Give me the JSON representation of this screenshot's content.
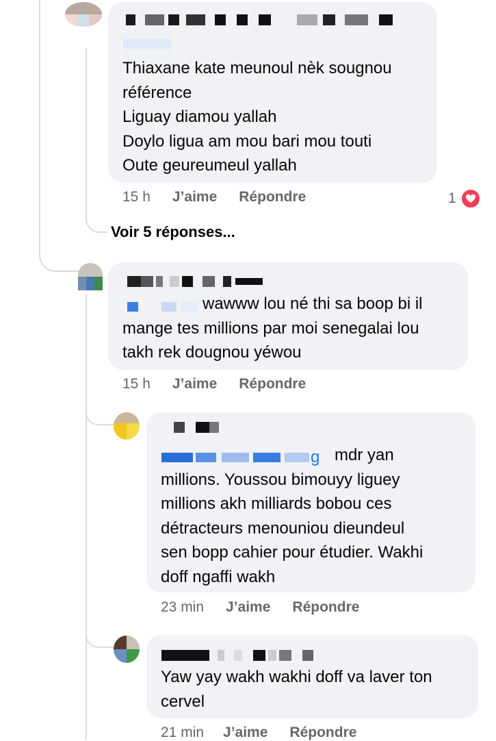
{
  "comments": [
    {
      "text": "Thiaxane kate meunoul nèk sougnou\nréférence\nLiguay diamou yallah\nDoylo ligua am mou bari mou touti\nOute geureumeul yallah",
      "time": "15 h",
      "like_label": "J’aime",
      "reply_label": "Répondre",
      "reaction_count": "1",
      "reaction_icon": "heart-icon"
    },
    {
      "text": "wawww lou né thi sa boop bi il\nmange tes millions par moi senegalai lou\ntakh rek dougnou yéwou",
      "time": "15 h",
      "like_label": "J’aime",
      "reply_label": "Répondre"
    },
    {
      "mention_tail": "g",
      "text": "mdr yan\nmillions.  Youssou bimouyy liguey\nmillions akh milliards bobou ces\ndétracteurs menouniou dieundeul\nsen bopp cahier pour étudier.  Wakhi\ndoff ngaffi wakh",
      "time": "23 min",
      "like_label": "J’aime",
      "reply_label": "Répondre"
    },
    {
      "text": "Yaw yay wakh wakhi doff va laver ton\ncervel",
      "time": "21 min",
      "like_label": "J’aime",
      "reply_label": "Répondre"
    }
  ],
  "see_replies_label": "Voir 5 réponses...",
  "colors": {
    "bubble": "#f0f2f5",
    "meta_text": "#65676b",
    "heart": "#f33e58",
    "mention": "#1877f2"
  }
}
